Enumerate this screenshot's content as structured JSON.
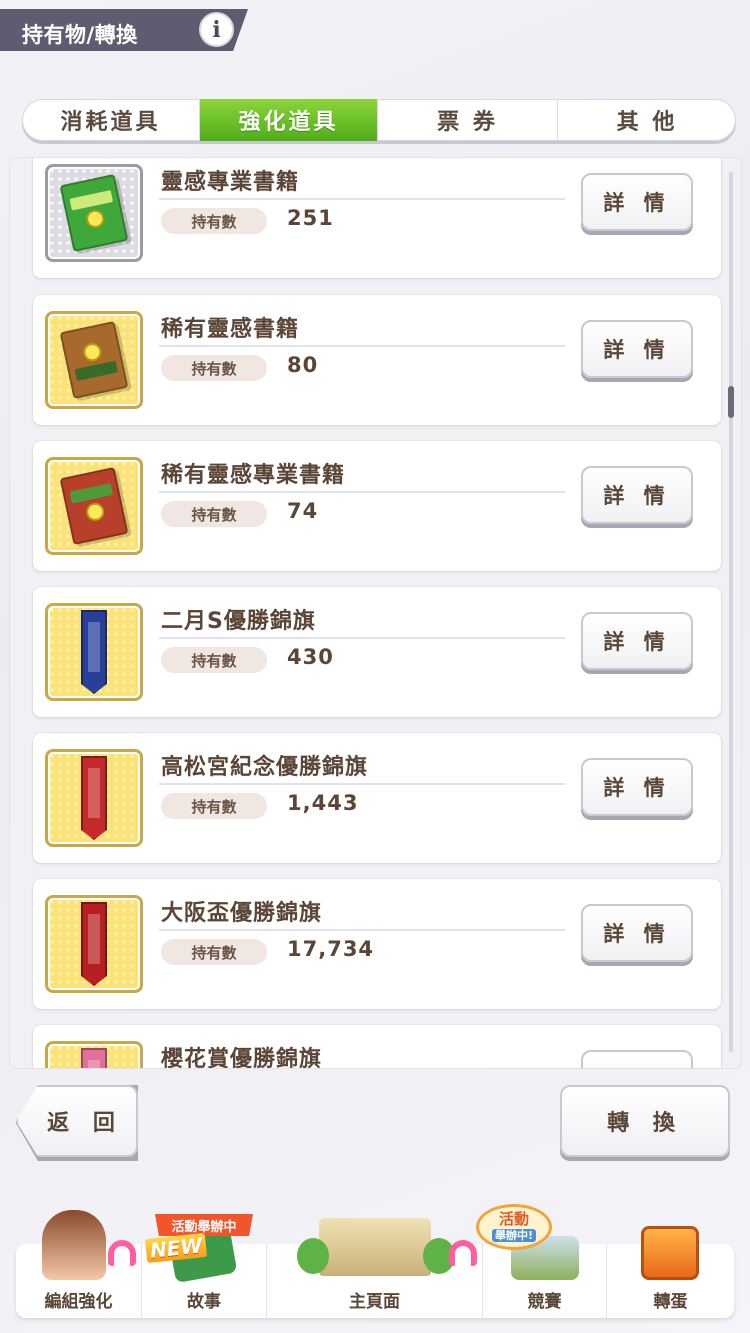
{
  "header": {
    "title": "持有物/轉換",
    "info_icon": "info-icon"
  },
  "tabs": [
    {
      "label": "消耗道具",
      "active": false
    },
    {
      "label": "強化道具",
      "active": true
    },
    {
      "label": "票 券",
      "active": false
    },
    {
      "label": "其 他",
      "active": false
    }
  ],
  "items": [
    {
      "name": "靈感專業書籍",
      "count_label": "持有數",
      "count": "251",
      "detail_label": "詳 情",
      "icon": "green-book-icon"
    },
    {
      "name": "稀有靈感書籍",
      "count_label": "持有數",
      "count": "80",
      "detail_label": "詳 情",
      "icon": "rare-book-icon"
    },
    {
      "name": "稀有靈感專業書籍",
      "count_label": "持有數",
      "count": "74",
      "detail_label": "詳 情",
      "icon": "rare-pro-book-icon"
    },
    {
      "name": "二月S優勝錦旗",
      "count_label": "持有數",
      "count": "430",
      "detail_label": "詳 情",
      "icon": "blue-pennant-icon"
    },
    {
      "name": "高松宮紀念優勝錦旗",
      "count_label": "持有數",
      "count": "1,443",
      "detail_label": "詳 情",
      "icon": "red-pennant-icon"
    },
    {
      "name": "大阪盃優勝錦旗",
      "count_label": "持有數",
      "count": "17,734",
      "detail_label": "詳 情",
      "icon": "red-pennant-icon"
    },
    {
      "name": "櫻花賞優勝錦旗",
      "count_label": "持有數",
      "count": "",
      "detail_label": "",
      "icon": "pink-pennant-icon"
    }
  ],
  "buttons": {
    "back": "返 回",
    "convert": "轉 換"
  },
  "nav": {
    "items": [
      {
        "label": "編組強化"
      },
      {
        "label": "故事"
      },
      {
        "label": "主頁面"
      },
      {
        "label": "競賽"
      },
      {
        "label": "轉蛋"
      }
    ],
    "story_event_badge": "活動舉辦中",
    "story_new_badge": "NEW",
    "race_event_badge_line1": "活動",
    "race_event_badge_line2": "舉辦中!"
  },
  "colors": {
    "active_tab": "#5bb81f",
    "header_bg": "#5d5c70",
    "event_badge": "#f2552a",
    "text_brown": "#5b4537"
  }
}
